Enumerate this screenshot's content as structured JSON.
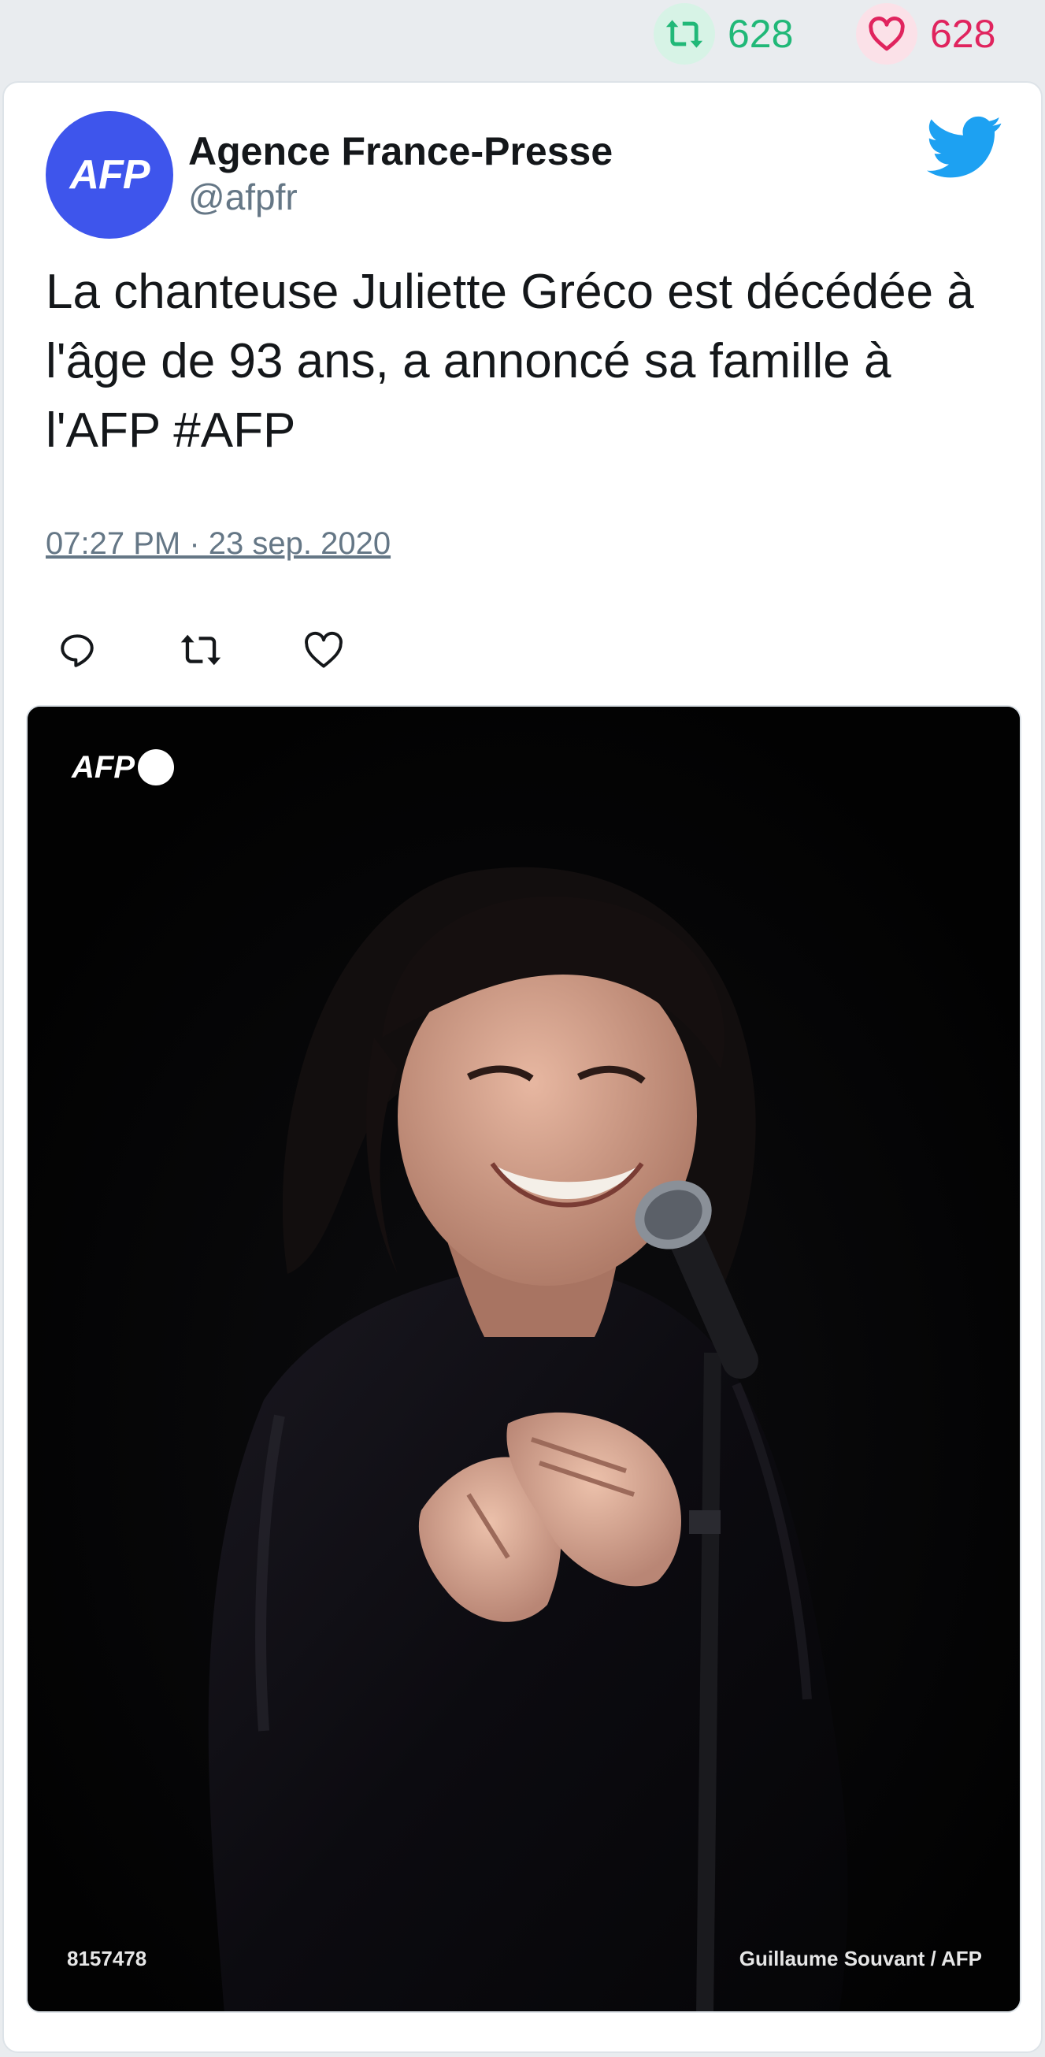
{
  "stats": {
    "retweet_count": "628",
    "like_count": "628",
    "retweet_color": "#21b878",
    "like_color": "#e0245e"
  },
  "tweet": {
    "avatar_text": "AFP",
    "author_name": "Agence France-Presse",
    "author_handle": "@afpfr",
    "text": "La chanteuse Juliette Gréco est décédée à l'âge de 93 ans, a annoncé sa famille à l'AFP #AFP",
    "timestamp": "07:27 PM · 23 sep. 2020",
    "brand_icon": "twitter-bird-icon",
    "brand_color": "#1da1f2",
    "avatar_color": "#3e55ec"
  },
  "actions": [
    {
      "icon": "reply-icon"
    },
    {
      "icon": "retweet-icon"
    },
    {
      "icon": "like-icon"
    }
  ],
  "media": {
    "watermark": "AFP",
    "photo_id": "8157478",
    "credit": "Guillaume Souvant / AFP"
  }
}
